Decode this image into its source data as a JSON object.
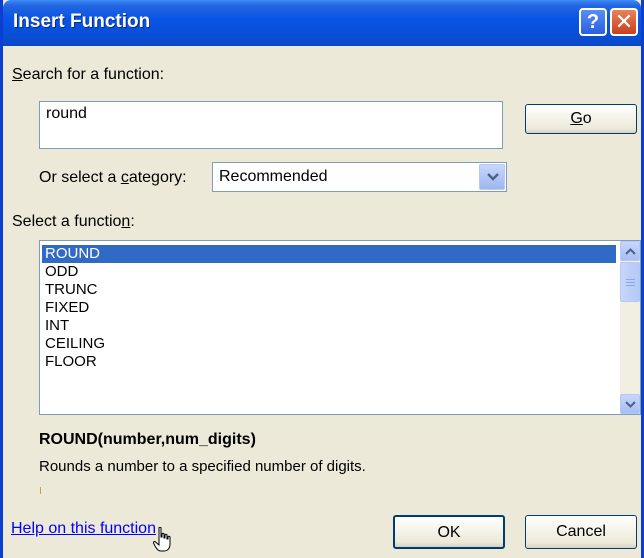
{
  "window": {
    "title": "Insert Function",
    "help_button": "?",
    "close_button": "✕"
  },
  "search": {
    "label_accel": "S",
    "label_rest": "earch for a function:",
    "value": "round",
    "go_accel": "G",
    "go_rest": "o"
  },
  "category": {
    "label_pre": "Or select a ",
    "label_accel": "c",
    "label_post": "ategory:",
    "selected": "Recommended"
  },
  "functions": {
    "label_pre": "Select a functio",
    "label_accel": "n",
    "label_post": ":",
    "items": [
      "ROUND",
      "ODD",
      "TRUNC",
      "FIXED",
      "INT",
      "CEILING",
      "FLOOR"
    ],
    "selected_index": 0
  },
  "details": {
    "signature": "ROUND(number,num_digits)",
    "description": "Rounds a number to a specified number of digits."
  },
  "footer": {
    "help_link": "Help on this function",
    "ok_label": "OK",
    "cancel_label": "Cancel"
  },
  "colors": {
    "titlebar": "#0a55e6",
    "selection": "#316ac5",
    "link": "#0000ff"
  },
  "icons": [
    "help-icon",
    "close-icon",
    "chevron-down-icon",
    "scroll-up-icon",
    "scroll-down-icon",
    "hand-cursor-icon"
  ]
}
